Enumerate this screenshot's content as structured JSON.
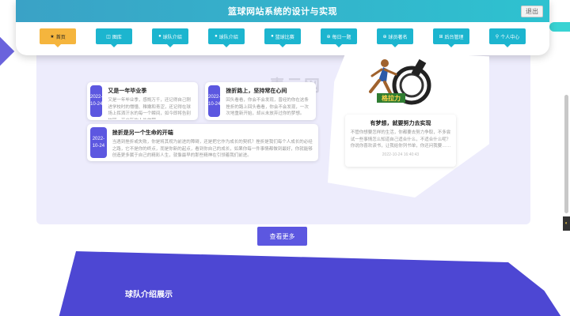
{
  "header": {
    "site_title": "篮球网站系统的设计与实现",
    "logout_label": "退出"
  },
  "nav": {
    "items": [
      {
        "label": "首页",
        "icon": "★"
      },
      {
        "label": "图库",
        "icon": "◫"
      },
      {
        "label": "球队介绍",
        "icon": "●"
      },
      {
        "label": "球队介绍",
        "icon": "●"
      },
      {
        "label": "篮球比赛",
        "icon": "●"
      },
      {
        "label": "每日一题",
        "icon": "⊕"
      },
      {
        "label": "球员著名",
        "icon": "⊕"
      },
      {
        "label": "后台管理",
        "icon": "⊞"
      },
      {
        "label": "个人中心",
        "icon": "⚲"
      }
    ]
  },
  "watermark": "青云网",
  "news": [
    {
      "date_line1": "2022-",
      "date_line2": "10-24",
      "title": "又是一年毕业季",
      "text": "又是一年毕业季，感慨万千，还记得自己刚进学校时的懵懂、稚嫩和青涩，还记得在球场上挥洒汗水的每一个瞬间，如今即将告别校园，开启新的人生旅程。"
    },
    {
      "date_line1": "2022-",
      "date_line2": "10-24",
      "title": "挫折路上，坚持常在心间",
      "text": "回头看看，你会不会发现，曾经的你在这条挫折的路上回头看看，你会不会发现，一次次地重新开始，却从未放弃过你的梦想。"
    },
    {
      "date": "2022-10-24",
      "title": "挫折是另一个生命的开端",
      "text": "当遇到挫折或失败，你是将其视为前进的障碍，还是把它作为成长的契机？挫折是我们每个人成长的必经之路，它不是你的终点，而是你新的起点，看到你自己的成长，如果你每一件事情都做到最好，你就能够创造更多属于自己的精彩人生，就像最早的那些精神在引领着我们前进。"
    }
  ],
  "feature": {
    "image_caption": "格拉力",
    "title": "有梦想，就要努力去实现",
    "text": "不管你想要怎样的生活，你都要去努力争取，不多尝试一些事情怎么知道自己适合什么，不适合什么呢？你说你喜欢读书，让我给你列书单，你还问我要……",
    "time": "2022-10-24 16:40:43"
  },
  "more_button_label": "查看更多",
  "team_section_title": "球队介绍展示",
  "side_widget_icon": "◐",
  "colors": {
    "header_bar": "#2ec2d0",
    "nav_item": "#1cb5cf",
    "nav_active": "#f5b53d",
    "accent": "#5c57e0"
  }
}
